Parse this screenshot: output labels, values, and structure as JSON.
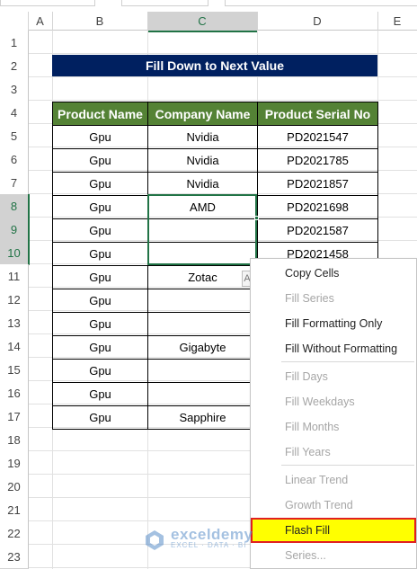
{
  "columns": [
    "A",
    "B",
    "C",
    "D",
    "E"
  ],
  "rows": [
    "1",
    "2",
    "3",
    "4",
    "5",
    "6",
    "7",
    "8",
    "9",
    "10",
    "11",
    "12",
    "13",
    "14",
    "15",
    "16",
    "17",
    "18",
    "19",
    "20",
    "21",
    "22",
    "23"
  ],
  "title": "Fill Down to Next Value",
  "table": {
    "headers": [
      "Product Name",
      "Company  Name",
      "Product Serial No"
    ],
    "rows": [
      [
        "Gpu",
        "Nvidia",
        "PD2021547"
      ],
      [
        "Gpu",
        "Nvidia",
        "PD2021785"
      ],
      [
        "Gpu",
        "Nvidia",
        "PD2021857"
      ],
      [
        "Gpu",
        "AMD",
        "PD2021698"
      ],
      [
        "Gpu",
        "",
        "PD2021587"
      ],
      [
        "Gpu",
        "",
        "PD2021458"
      ],
      [
        "Gpu",
        "Zotac",
        ""
      ],
      [
        "Gpu",
        "",
        ""
      ],
      [
        "Gpu",
        "",
        ""
      ],
      [
        "Gpu",
        "Gigabyte",
        ""
      ],
      [
        "Gpu",
        "",
        ""
      ],
      [
        "Gpu",
        "",
        ""
      ],
      [
        "Gpu",
        "Sapphire",
        ""
      ]
    ]
  },
  "autofill_button": "A",
  "menu": {
    "items": [
      {
        "label": "Copy Cells",
        "enabled": true
      },
      {
        "label": "Fill Series",
        "enabled": false
      },
      {
        "label": "Fill Formatting Only",
        "enabled": true
      },
      {
        "label": "Fill Without Formatting",
        "enabled": true
      },
      {
        "label": "Fill Days",
        "enabled": false
      },
      {
        "label": "Fill Weekdays",
        "enabled": false
      },
      {
        "label": "Fill Months",
        "enabled": false
      },
      {
        "label": "Fill Years",
        "enabled": false
      },
      {
        "label": "Linear Trend",
        "enabled": false
      },
      {
        "label": "Growth Trend",
        "enabled": false
      },
      {
        "label": "Flash Fill",
        "enabled": true,
        "highlighted": true
      },
      {
        "label": "Series...",
        "enabled": false
      }
    ]
  },
  "watermark": {
    "name": "exceldemy",
    "tagline": "EXCEL · DATA · BI"
  },
  "colors": {
    "title_bg": "#002060",
    "header_bg": "#548235",
    "selection": "#217346",
    "highlight": "#ffff00",
    "highlight_border": "#e02020"
  }
}
